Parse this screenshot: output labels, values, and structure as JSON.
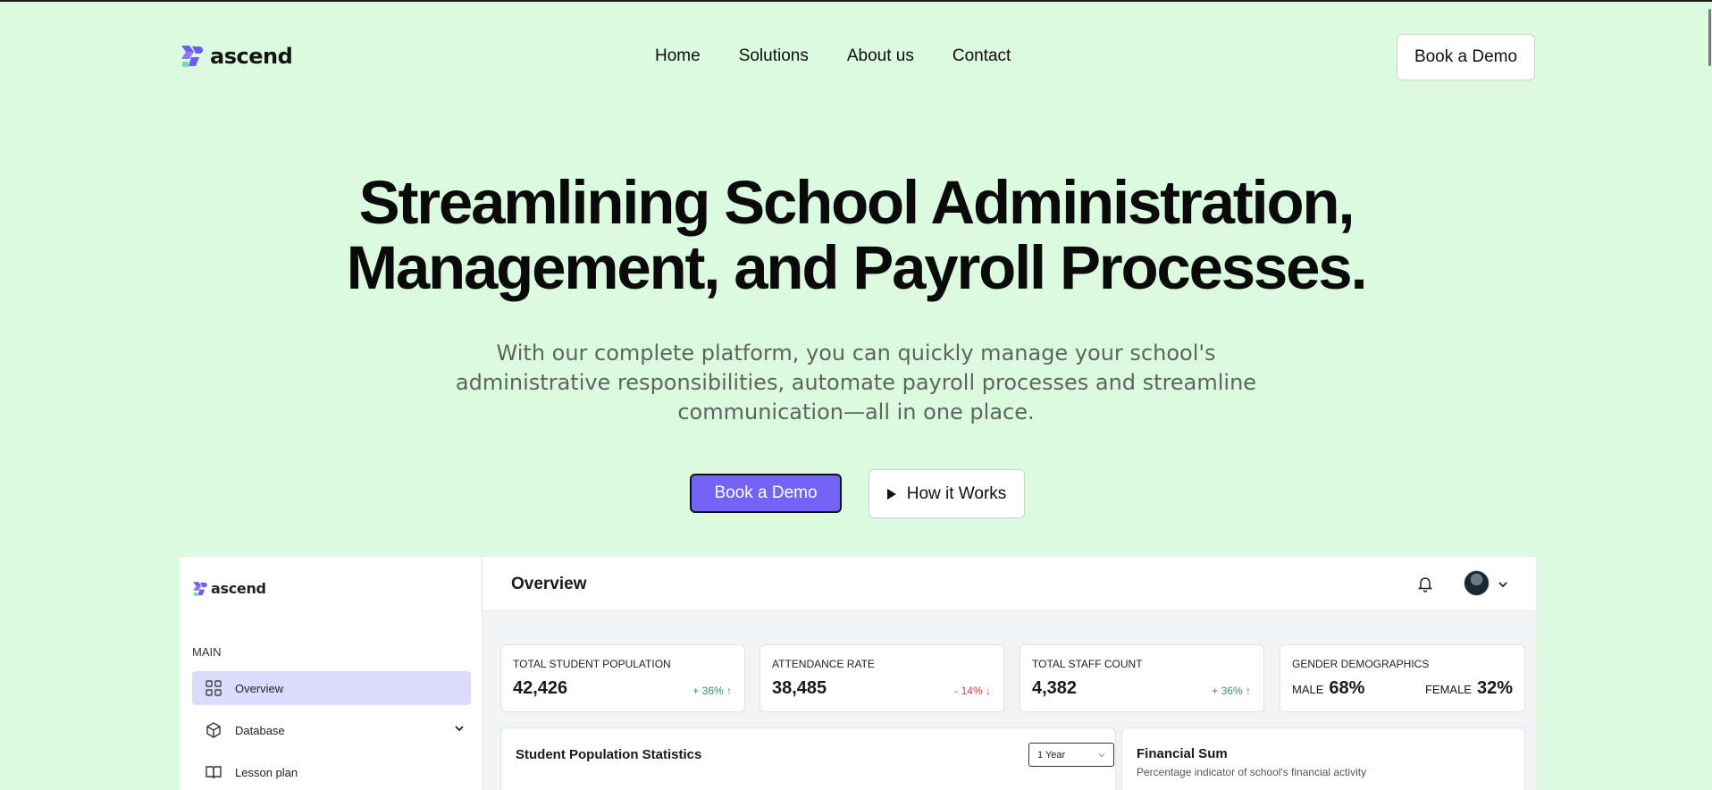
{
  "brand": {
    "name": "ascend",
    "accent": "#7463f7",
    "background": "#dcfadf"
  },
  "nav": {
    "links": [
      "Home",
      "Solutions",
      "About us",
      "Contact"
    ],
    "cta": "Book a Demo"
  },
  "hero": {
    "title_line1": "Streamlining School Administration,",
    "title_line2": "Management, and Payroll Processes.",
    "subtitle_line1": "With our complete platform, you can quickly manage your school's",
    "subtitle_line2": "administrative responsibilities, automate payroll processes and streamline",
    "subtitle_line3": "communication—all in one place.",
    "primary_cta": "Book a Demo",
    "secondary_cta": "How it Works"
  },
  "dashboard": {
    "logo": "ascend",
    "sidebar": {
      "section": "MAIN",
      "items": [
        {
          "label": "Overview",
          "icon": "grid-icon",
          "active": true
        },
        {
          "label": "Database",
          "icon": "cube-icon",
          "expandable": true
        },
        {
          "label": "Lesson plan",
          "icon": "book-icon"
        }
      ]
    },
    "topbar": {
      "title": "Overview"
    },
    "stats": [
      {
        "label": "TOTAL STUDENT POPULATION",
        "value": "42,426",
        "delta": "+ 36%",
        "direction": "up"
      },
      {
        "label": "ATTENDANCE RATE",
        "value": "38,485",
        "delta": "- 14%",
        "direction": "down"
      },
      {
        "label": "TOTAL STAFF COUNT",
        "value": "4,382",
        "delta": "+ 36%",
        "direction": "up"
      }
    ],
    "gender": {
      "label": "GENDER DEMOGRAPHICS",
      "male_label": "MALE",
      "male_value": "68%",
      "female_label": "FEMALE",
      "female_value": "32%"
    },
    "population_panel": {
      "title": "Student Population Statistics",
      "range": "1 Year"
    },
    "finance_panel": {
      "title": "Financial Sum",
      "subtitle": "Percentage indicator of school's financial activity"
    }
  }
}
